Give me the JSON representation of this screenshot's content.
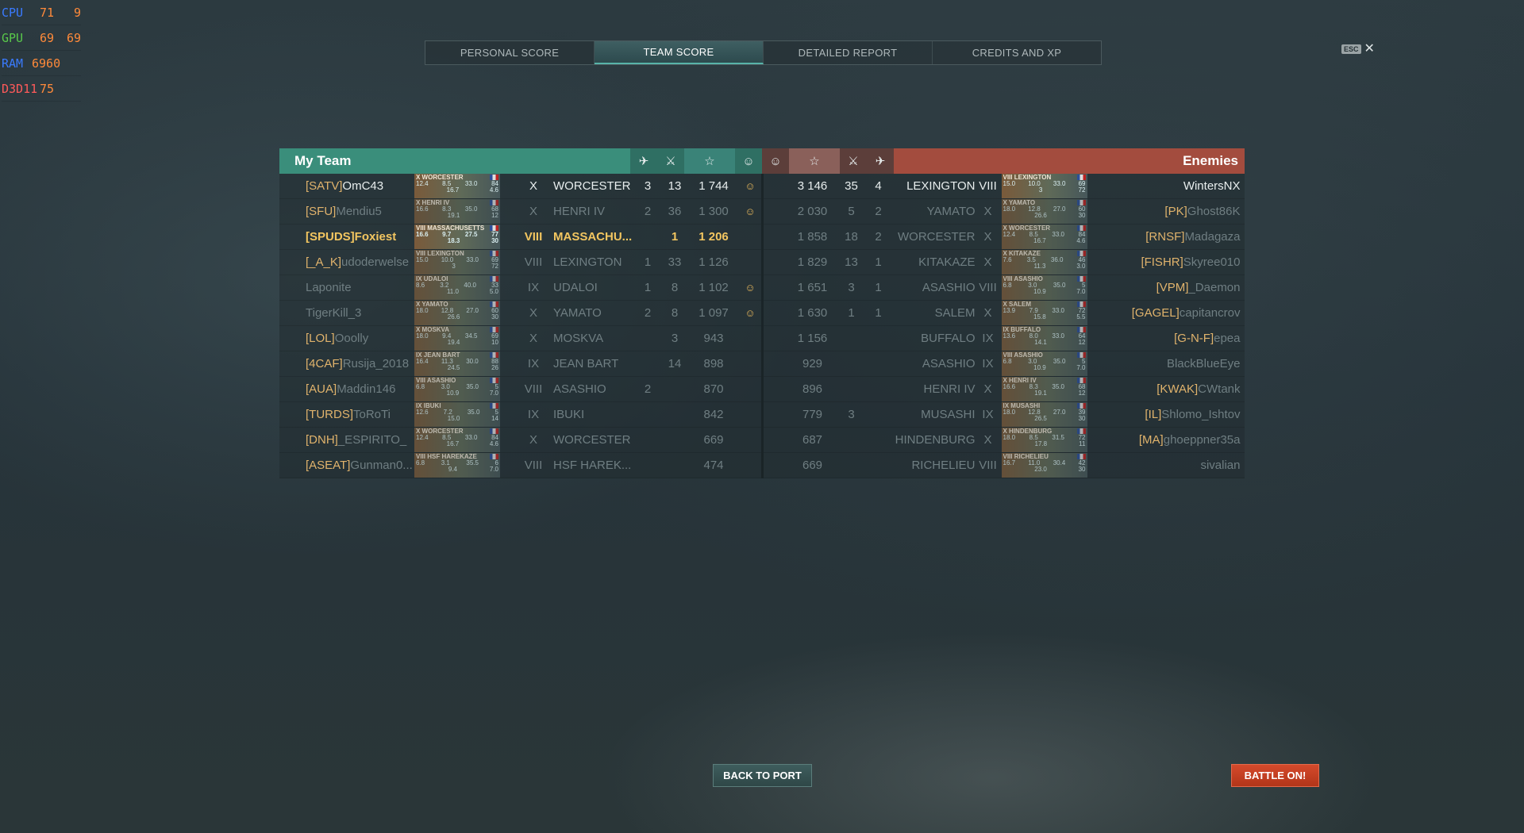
{
  "hud": [
    {
      "label": "CPU",
      "v1": "71",
      "v2": "9"
    },
    {
      "label": "GPU",
      "v1": "69",
      "v2": "69"
    },
    {
      "label": "RAM",
      "v1": "6960",
      "v2": ""
    },
    {
      "label": "D3D11",
      "v1": "75",
      "v2": ""
    }
  ],
  "tabs": [
    "PERSONAL SCORE",
    "TEAM SCORE",
    "DETAILED REPORT",
    "CREDITS AND XP"
  ],
  "active_tab": "TEAM SCORE",
  "esc_label": "ESC",
  "my_team_label": "My Team",
  "enemies_label": "Enemies",
  "header_icons": [
    "plane-icon",
    "crossed-swords-icon",
    "star-icon",
    "medal-icon"
  ],
  "my_team": [
    {
      "tag": "[SATV]",
      "name": "OmC43",
      "card": "X WORCESTER",
      "s1": "12.4",
      "s2": "8.5",
      "s3": "33.0",
      "s4": "84",
      "s5": "16.7",
      "s6": "4.6",
      "tier": "X",
      "ship": "WORCESTER",
      "c1": "3",
      "c2": "13",
      "xp": "1 744",
      "medal": "☺",
      "style": "bright"
    },
    {
      "tag": "[SFU]",
      "name": "Mendiu5",
      "card": "X HENRI IV",
      "s1": "16.6",
      "s2": "8.3",
      "s3": "35.0",
      "s4": "68",
      "s5": "19.1",
      "s6": "12",
      "tier": "X",
      "ship": "HENRI IV",
      "c1": "2",
      "c2": "36",
      "xp": "1 300",
      "medal": "☺",
      "style": "dim"
    },
    {
      "tag": "[SPUDS]",
      "name": "Foxiest",
      "card": "VIII MASSACHUSETTS",
      "s1": "16.6",
      "s2": "9.7",
      "s3": "27.5",
      "s4": "77",
      "s5": "18.3",
      "s6": "30",
      "tier": "VIII",
      "ship": "MASSACHU...",
      "c1": "",
      "c2": "1",
      "xp": "1 206",
      "medal": "",
      "style": "hl"
    },
    {
      "tag": "[_A_K]",
      "name": "udoderwelse",
      "card": "VIII LEXINGTON",
      "s1": "15.0",
      "s2": "10.0",
      "s3": "33.0",
      "s4": "69",
      "s5": "3",
      "s6": "72",
      "tier": "VIII",
      "ship": "LEXINGTON",
      "c1": "1",
      "c2": "33",
      "xp": "1 126",
      "medal": "",
      "style": "dim"
    },
    {
      "tag": "",
      "name": "Laponite",
      "card": "IX UDALOI",
      "s1": "8.6",
      "s2": "3.2",
      "s3": "40.0",
      "s4": "33",
      "s5": "11.0",
      "s6": "5.0",
      "tier": "IX",
      "ship": "UDALOI",
      "c1": "1",
      "c2": "8",
      "xp": "1 102",
      "medal": "☺",
      "style": "dim"
    },
    {
      "tag": "",
      "name": "TigerKill_3",
      "card": "X YAMATO",
      "s1": "18.0",
      "s2": "12.8",
      "s3": "27.0",
      "s4": "60",
      "s5": "26.6",
      "s6": "30",
      "tier": "X",
      "ship": "YAMATO",
      "c1": "2",
      "c2": "8",
      "xp": "1 097",
      "medal": "☺",
      "style": "dim"
    },
    {
      "tag": "[LOL]",
      "name": "Ooolly",
      "card": "X MOSKVA",
      "s1": "18.0",
      "s2": "9.4",
      "s3": "34.5",
      "s4": "69",
      "s5": "19.4",
      "s6": "10",
      "tier": "X",
      "ship": "MOSKVA",
      "c1": "",
      "c2": "3",
      "xp": "943",
      "medal": "",
      "style": "dim"
    },
    {
      "tag": "[4CAF]",
      "name": "Rusija_2018",
      "card": "IX JEAN BART",
      "s1": "16.4",
      "s2": "11.3",
      "s3": "30.0",
      "s4": "88",
      "s5": "24.5",
      "s6": "26",
      "tier": "IX",
      "ship": "JEAN BART",
      "c1": "",
      "c2": "14",
      "xp": "898",
      "medal": "",
      "style": "dim"
    },
    {
      "tag": "[AUA]",
      "name": "Maddin146",
      "card": "VIII ASASHIO",
      "s1": "6.8",
      "s2": "3.0",
      "s3": "35.0",
      "s4": "5",
      "s5": "10.9",
      "s6": "7.0",
      "tier": "VIII",
      "ship": "ASASHIO",
      "c1": "2",
      "c2": "",
      "xp": "870",
      "medal": "",
      "style": "dim"
    },
    {
      "tag": "[TURDS]",
      "name": "ToRoTi",
      "card": "IX IBUKI",
      "s1": "12.6",
      "s2": "7.2",
      "s3": "35.0",
      "s4": "5",
      "s5": "15.0",
      "s6": "14",
      "tier": "IX",
      "ship": "IBUKI",
      "c1": "",
      "c2": "",
      "xp": "842",
      "medal": "",
      "style": "dim"
    },
    {
      "tag": "[DNH]",
      "name": "_ESPIRITO_",
      "card": "X WORCESTER",
      "s1": "12.4",
      "s2": "8.5",
      "s3": "33.0",
      "s4": "84",
      "s5": "16.7",
      "s6": "4.6",
      "tier": "X",
      "ship": "WORCESTER",
      "c1": "",
      "c2": "",
      "xp": "669",
      "medal": "",
      "style": "dim"
    },
    {
      "tag": "[ASEAT]",
      "name": "Gunman0...",
      "card": "VIII HSF HAREKAZE",
      "s1": "6.8",
      "s2": "3.1",
      "s3": "35.5",
      "s4": "6",
      "s5": "9.4",
      "s6": "7.0",
      "tier": "VIII",
      "ship": "HSF HAREK...",
      "c1": "",
      "c2": "",
      "xp": "474",
      "medal": "",
      "style": "dim"
    }
  ],
  "enemies": [
    {
      "tag": "",
      "name": "WintersNX",
      "card": "VIII LEXINGTON",
      "s1": "15.0",
      "s2": "10.0",
      "s3": "33.0",
      "s4": "69",
      "s5": "3",
      "s6": "72",
      "tier": "VIII",
      "ship": "LEXINGTON",
      "c1": "4",
      "c2": "35",
      "xp": "3 146",
      "medal": "",
      "style": "bright"
    },
    {
      "tag": "[PK]",
      "name": "Ghost86K",
      "card": "X YAMATO",
      "s1": "18.0",
      "s2": "12.8",
      "s3": "27.0",
      "s4": "60",
      "s5": "26.6",
      "s6": "30",
      "tier": "X",
      "ship": "YAMATO",
      "c1": "2",
      "c2": "5",
      "xp": "2 030",
      "medal": "",
      "style": "dim"
    },
    {
      "tag": "[RNSF]",
      "name": "Madagaza",
      "card": "X WORCESTER",
      "s1": "12.4",
      "s2": "8.5",
      "s3": "33.0",
      "s4": "84",
      "s5": "16.7",
      "s6": "4.6",
      "tier": "X",
      "ship": "WORCESTER",
      "c1": "2",
      "c2": "18",
      "xp": "1 858",
      "medal": "",
      "style": "dim"
    },
    {
      "tag": "[FISHR]",
      "name": "Skyree010",
      "card": "X KITAKAZE",
      "s1": "7.6",
      "s2": "3.5",
      "s3": "36.0",
      "s4": "46",
      "s5": "11.3",
      "s6": "3.0",
      "tier": "X",
      "ship": "KITAKAZE",
      "c1": "1",
      "c2": "13",
      "xp": "1 829",
      "medal": "",
      "style": "dim"
    },
    {
      "tag": "[VPM]",
      "name": "_Daemon",
      "card": "VIII ASASHIO",
      "s1": "6.8",
      "s2": "3.0",
      "s3": "35.0",
      "s4": "5",
      "s5": "10.9",
      "s6": "7.0",
      "tier": "VIII",
      "ship": "ASASHIO",
      "c1": "1",
      "c2": "3",
      "xp": "1 651",
      "medal": "",
      "style": "dim"
    },
    {
      "tag": "[GAGEL]",
      "name": "capitancrov",
      "card": "X SALEM",
      "s1": "13.9",
      "s2": "7.9",
      "s3": "33.0",
      "s4": "72",
      "s5": "15.8",
      "s6": "5.5",
      "tier": "X",
      "ship": "SALEM",
      "c1": "1",
      "c2": "1",
      "xp": "1 630",
      "medal": "",
      "style": "dim"
    },
    {
      "tag": "[G-N-F]",
      "name": "epea",
      "card": "IX BUFFALO",
      "s1": "13.6",
      "s2": "8.0",
      "s3": "33.0",
      "s4": "64",
      "s5": "14.1",
      "s6": "12",
      "tier": "IX",
      "ship": "BUFFALO",
      "c1": "",
      "c2": "",
      "xp": "1 156",
      "medal": "",
      "style": "dim"
    },
    {
      "tag": "",
      "name": "BlackBlueEye",
      "card": "VIII ASASHIO",
      "s1": "6.8",
      "s2": "3.0",
      "s3": "35.0",
      "s4": "5",
      "s5": "10.9",
      "s6": "7.0",
      "tier": "IX",
      "ship": "ASASHIO",
      "c1": "",
      "c2": "",
      "xp": "929",
      "medal": "",
      "style": "dim"
    },
    {
      "tag": "[KWAK]",
      "name": "CWtank",
      "card": "X HENRI IV",
      "s1": "16.6",
      "s2": "8.3",
      "s3": "35.0",
      "s4": "68",
      "s5": "19.1",
      "s6": "12",
      "tier": "X",
      "ship": "HENRI IV",
      "c1": "",
      "c2": "",
      "xp": "896",
      "medal": "",
      "style": "dim"
    },
    {
      "tag": "[IL]",
      "name": "Shlomo_Ishtov",
      "card": "IX MUSASHI",
      "s1": "18.0",
      "s2": "12.8",
      "s3": "27.0",
      "s4": "39",
      "s5": "26.5",
      "s6": "30",
      "tier": "IX",
      "ship": "MUSASHI",
      "c1": "",
      "c2": "3",
      "xp": "779",
      "medal": "",
      "style": "dim"
    },
    {
      "tag": "[MA]",
      "name": "ghoeppner35a",
      "card": "X HINDENBURG",
      "s1": "18.0",
      "s2": "8.5",
      "s3": "31.5",
      "s4": "72",
      "s5": "17.8",
      "s6": "11",
      "tier": "X",
      "ship": "HINDENBURG",
      "c1": "",
      "c2": "",
      "xp": "687",
      "medal": "",
      "style": "dim"
    },
    {
      "tag": "",
      "name": "sivalian",
      "card": "VIII RICHELIEU",
      "s1": "16.7",
      "s2": "11.0",
      "s3": "30.4",
      "s4": "42",
      "s5": "23.0",
      "s6": "30",
      "tier": "VIII",
      "ship": "RICHELIEU",
      "c1": "",
      "c2": "",
      "xp": "669",
      "medal": "",
      "style": "dim"
    }
  ],
  "buttons": {
    "back": "BACK TO PORT",
    "battle": "BATTLE ON!"
  }
}
